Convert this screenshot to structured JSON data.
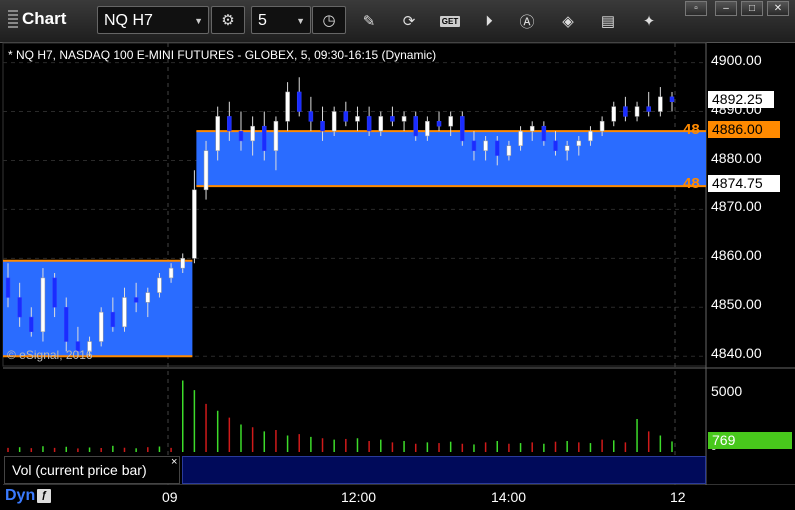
{
  "app": {
    "title": "Chart"
  },
  "toolbar": {
    "symbol": "NQ H7",
    "interval": "5",
    "buttons": [
      "settings-icon",
      "clock-icon",
      "pencil-icon",
      "refresh-icon",
      "get-icon",
      "play-icon",
      "alert-icon",
      "tag-icon",
      "comment-icon",
      "twitter-icon"
    ],
    "get_label": "GET"
  },
  "window_controls": {
    "restore": "▫",
    "minimize": "–",
    "maximize": "□",
    "close": "✕"
  },
  "chart": {
    "header": "* NQ H7, NASDAQ 100 E-MINI FUTURES - GLOBEX, 5, 09:30-16:15 (Dynamic)",
    "watermark": "© eSignal, 2016",
    "price_axis": [
      "4900.00",
      "4890.00",
      "4880.00",
      "4870.00",
      "4860.00",
      "4850.00",
      "4840.00"
    ],
    "current_price": "4892.25",
    "level_upper": "4886.00",
    "level_lower": "4874.75",
    "level_label_upper": "48",
    "level_label_lower": "48",
    "volume_axis": [
      "5000",
      "0"
    ],
    "volume_current": "769",
    "volume_panel_title": "Vol (current price bar)",
    "volume_close": "×",
    "mode_label": "Dyn",
    "mode_icon": "fx-icon",
    "time_axis": [
      "09",
      "12:00",
      "14:00",
      "12"
    ],
    "colors": {
      "box_fill": "#2a6cff",
      "box_border": "#ff8a00",
      "bull": "#ffffff",
      "bear": "#1a2cff",
      "vol_up": "#3ddc2a",
      "vol_down": "#d01a1a",
      "current_vol_tag": "#48c81c"
    }
  },
  "chart_data": {
    "type": "candlestick",
    "y_range": [
      4838,
      4904
    ],
    "boxes": [
      {
        "time_range": [
          "prior session close",
          "09:30"
        ],
        "high": 4859.5,
        "low": 4840.0
      },
      {
        "time_range": [
          "09:30",
          "close"
        ],
        "high": 4886.0,
        "low": 4874.75
      }
    ],
    "candles": [
      [
        4856,
        4859,
        4850,
        4852
      ],
      [
        4852,
        4855,
        4846,
        4848
      ],
      [
        4848,
        4850,
        4844,
        4845
      ],
      [
        4845,
        4858,
        4843,
        4856
      ],
      [
        4856,
        4857,
        4848,
        4850
      ],
      [
        4850,
        4852,
        4841,
        4843
      ],
      [
        4843,
        4846,
        4840,
        4841
      ],
      [
        4841,
        4844,
        4840,
        4843
      ],
      [
        4843,
        4850,
        4842,
        4849
      ],
      [
        4849,
        4852,
        4845,
        4846
      ],
      [
        4846,
        4854,
        4845,
        4852
      ],
      [
        4852,
        4855,
        4849,
        4851
      ],
      [
        4851,
        4854,
        4848,
        4853
      ],
      [
        4853,
        4857,
        4852,
        4856
      ],
      [
        4856,
        4859,
        4855,
        4858
      ],
      [
        4858,
        4861,
        4857,
        4860
      ],
      [
        4860,
        4878,
        4859,
        4874
      ],
      [
        4874,
        4884,
        4872,
        4882
      ],
      [
        4882,
        4891,
        4880,
        4889
      ],
      [
        4889,
        4892,
        4884,
        4886
      ],
      [
        4886,
        4890,
        4882,
        4884
      ],
      [
        4884,
        4889,
        4881,
        4887
      ],
      [
        4887,
        4890,
        4880,
        4882
      ],
      [
        4882,
        4889,
        4878,
        4888
      ],
      [
        4888,
        4896,
        4886,
        4894
      ],
      [
        4894,
        4897,
        4889,
        4890
      ],
      [
        4890,
        4893,
        4886,
        4888
      ],
      [
        4888,
        4891,
        4884,
        4886
      ],
      [
        4886,
        4891,
        4885,
        4890
      ],
      [
        4890,
        4892,
        4887,
        4888
      ],
      [
        4888,
        4891,
        4886,
        4889
      ],
      [
        4889,
        4891,
        4885,
        4886
      ],
      [
        4886,
        4890,
        4885,
        4889
      ],
      [
        4889,
        4891,
        4887,
        4888
      ],
      [
        4888,
        4890,
        4886,
        4889
      ],
      [
        4889,
        4890,
        4884,
        4885
      ],
      [
        4885,
        4889,
        4884,
        4888
      ],
      [
        4888,
        4890,
        4886,
        4887
      ],
      [
        4887,
        4890,
        4885,
        4889
      ],
      [
        4889,
        4890,
        4883,
        4884
      ],
      [
        4884,
        4886,
        4880,
        4882
      ],
      [
        4882,
        4885,
        4880,
        4884
      ],
      [
        4884,
        4885,
        4879,
        4881
      ],
      [
        4881,
        4884,
        4880,
        4883
      ],
      [
        4883,
        4887,
        4882,
        4886
      ],
      [
        4886,
        4888,
        4884,
        4887
      ],
      [
        4887,
        4888,
        4883,
        4884
      ],
      [
        4884,
        4886,
        4881,
        4882
      ],
      [
        4882,
        4884,
        4880,
        4883
      ],
      [
        4883,
        4885,
        4881,
        4884
      ],
      [
        4884,
        4887,
        4883,
        4886
      ],
      [
        4886,
        4889,
        4885,
        4888
      ],
      [
        4888,
        4892,
        4887,
        4891
      ],
      [
        4891,
        4893,
        4888,
        4889
      ],
      [
        4889,
        4892,
        4888,
        4891
      ],
      [
        4891,
        4894,
        4889,
        4890
      ],
      [
        4890,
        4895,
        4889,
        4893
      ],
      [
        4893,
        4894,
        4890,
        4892
      ]
    ],
    "volume": [
      [
        300,
        0
      ],
      [
        350,
        1
      ],
      [
        280,
        0
      ],
      [
        420,
        1
      ],
      [
        300,
        0
      ],
      [
        380,
        1
      ],
      [
        260,
        0
      ],
      [
        330,
        1
      ],
      [
        290,
        0
      ],
      [
        450,
        1
      ],
      [
        310,
        0
      ],
      [
        270,
        1
      ],
      [
        350,
        0
      ],
      [
        400,
        1
      ],
      [
        300,
        0
      ],
      [
        5200,
        1
      ],
      [
        4500,
        1
      ],
      [
        3500,
        0
      ],
      [
        3000,
        1
      ],
      [
        2500,
        0
      ],
      [
        2000,
        1
      ],
      [
        1800,
        0
      ],
      [
        1500,
        1
      ],
      [
        1600,
        0
      ],
      [
        1200,
        1
      ],
      [
        1300,
        0
      ],
      [
        1100,
        1
      ],
      [
        1000,
        0
      ],
      [
        900,
        1
      ],
      [
        950,
        0
      ],
      [
        1000,
        1
      ],
      [
        800,
        0
      ],
      [
        900,
        1
      ],
      [
        700,
        0
      ],
      [
        800,
        1
      ],
      [
        600,
        0
      ],
      [
        700,
        1
      ],
      [
        650,
        0
      ],
      [
        750,
        1
      ],
      [
        600,
        0
      ],
      [
        550,
        1
      ],
      [
        700,
        0
      ],
      [
        800,
        1
      ],
      [
        600,
        0
      ],
      [
        650,
        1
      ],
      [
        700,
        0
      ],
      [
        600,
        1
      ],
      [
        750,
        0
      ],
      [
        800,
        1
      ],
      [
        700,
        0
      ],
      [
        650,
        1
      ],
      [
        900,
        0
      ],
      [
        850,
        1
      ],
      [
        700,
        0
      ],
      [
        2400,
        1
      ],
      [
        1500,
        0
      ],
      [
        1200,
        1
      ],
      [
        769,
        1
      ]
    ]
  }
}
